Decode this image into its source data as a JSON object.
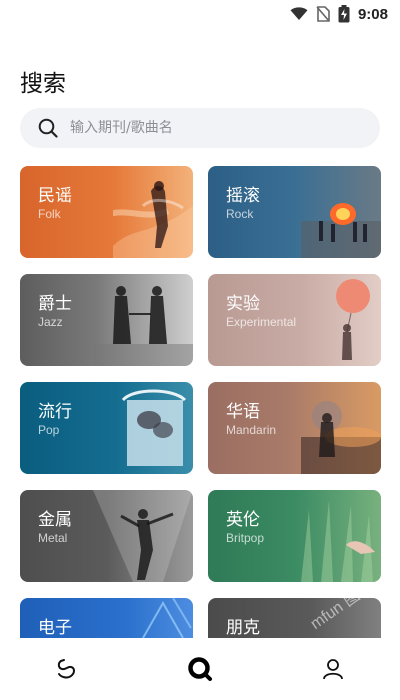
{
  "status": {
    "time": "9:08"
  },
  "page": {
    "title": "搜索"
  },
  "search": {
    "placeholder": "输入期刊/歌曲名"
  },
  "genres": [
    {
      "title": "民谣",
      "subtitle": "Folk"
    },
    {
      "title": "摇滚",
      "subtitle": "Rock"
    },
    {
      "title": "爵士",
      "subtitle": "Jazz"
    },
    {
      "title": "实验",
      "subtitle": "Experimental"
    },
    {
      "title": "流行",
      "subtitle": "Pop"
    },
    {
      "title": "华语",
      "subtitle": "Mandarin"
    },
    {
      "title": "金属",
      "subtitle": "Metal"
    },
    {
      "title": "英伦",
      "subtitle": "Britpop"
    },
    {
      "title": "电子",
      "subtitle": ""
    },
    {
      "title": "朋克",
      "subtitle": ""
    }
  ],
  "watermark": "mfun 图",
  "tabbar": {
    "items": [
      {
        "icon": "swan-logo-icon"
      },
      {
        "icon": "search-icon",
        "active": true
      },
      {
        "icon": "profile-icon"
      }
    ]
  }
}
